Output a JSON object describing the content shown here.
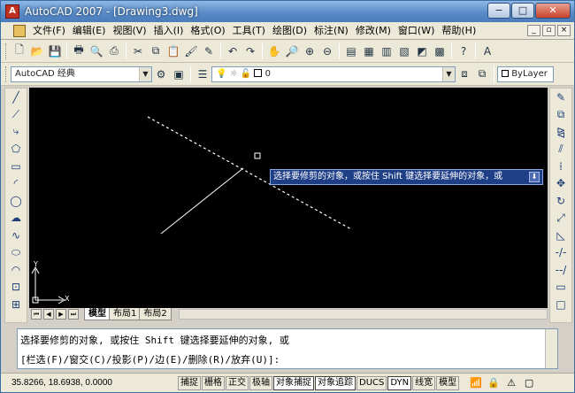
{
  "window": {
    "title": "AutoCAD 2007 - [Drawing3.dwg]",
    "app_icon": "autocad-logo",
    "controls": [
      "−",
      "□",
      "✕"
    ]
  },
  "menubar": {
    "items": [
      "文件(F)",
      "编辑(E)",
      "视图(V)",
      "插入(I)",
      "格式(O)",
      "工具(T)",
      "绘图(D)",
      "标注(N)",
      "修改(M)",
      "窗口(W)",
      "帮助(H)"
    ],
    "mdi_controls": [
      "_",
      "▫",
      "×"
    ]
  },
  "toolbar2": {
    "workspace": "AutoCAD 经典",
    "layer": "0",
    "linetype": "ByLayer"
  },
  "tooltip": {
    "text": "选择要修剪的对象，或按住 Shift 键选择要延伸的对象，或",
    "button": "⬇"
  },
  "layout_tabs": [
    "模型",
    "布局1",
    "布局2"
  ],
  "command": {
    "line1": "选择要修剪的对象, 或按住 Shift 键选择要延伸的对象, 或",
    "line2": "[栏选(F)/窗交(C)/投影(P)/边(E)/删除(R)/放弃(U)]:"
  },
  "statusbar": {
    "coords": "35.8266, 18.6938, 0.0000",
    "buttons": [
      "捕捉",
      "栅格",
      "正交",
      "极轴",
      "对象捕捉",
      "对象追踪",
      "DUCS",
      "DYN",
      "线宽",
      "模型"
    ]
  },
  "ucs": {
    "x_label": "X",
    "y_label": "Y"
  },
  "colors": {
    "title_bar": "#5a8cc8",
    "canvas": "#000000",
    "tooltip_bg": "#1e3e86"
  }
}
